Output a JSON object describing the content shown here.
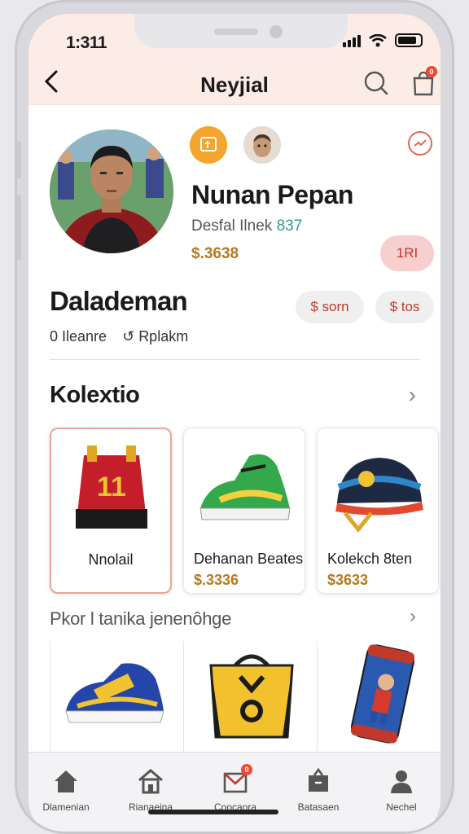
{
  "status": {
    "time": "1:311"
  },
  "nav": {
    "title": "Neyjial",
    "back_icon": "chevron-left-icon",
    "search_icon": "search-icon",
    "bag_icon": "shopping-bag-icon",
    "bag_badge": "0"
  },
  "profile": {
    "name": "Nunan Pepan",
    "detail": "Desfal Ilnek",
    "detail_number": "837",
    "price": "$.3638",
    "button_label": "1RI"
  },
  "section_header": {
    "title": "Dalademan",
    "stat1": "0 Ileanre",
    "stat2": "Rplakm",
    "stat2_icon": "refresh-icon",
    "action1": "$ sorn",
    "action2": "$ tos"
  },
  "collection": {
    "title": "Kolextio",
    "items": [
      {
        "label": "Nnolail",
        "price": ""
      },
      {
        "label": "Dehanan Beates",
        "price": "$.3336"
      },
      {
        "label": "Kolekch 8ten",
        "price": "$3633"
      }
    ]
  },
  "recommend": {
    "title": "Pkor l tanika jenenôhge"
  },
  "tabs": [
    {
      "label": "Dlamenian",
      "icon": "home-icon"
    },
    {
      "label": "Rianaeina",
      "icon": "house-icon"
    },
    {
      "label": "Coocaora",
      "icon": "inbox-icon",
      "badge": "0"
    },
    {
      "label": "Batasaen",
      "icon": "tag-icon"
    },
    {
      "label": "Nechel",
      "icon": "user-icon"
    }
  ],
  "colors": {
    "accent": "#ea4b35",
    "gold": "#b7791f",
    "header_bg": "#fbece6",
    "pill_pink": "#f7cfcf"
  }
}
